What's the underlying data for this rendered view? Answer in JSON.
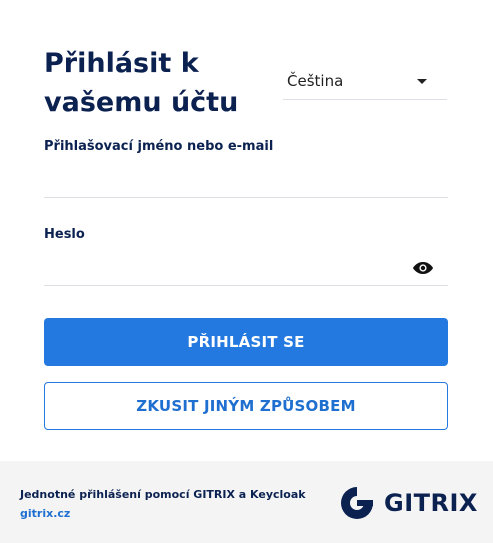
{
  "login": {
    "title": "Přihlásit k vašemu účtu",
    "language": {
      "selected": "Čeština",
      "caret_icon": "chevron-down-icon"
    },
    "username": {
      "label": "Přihlašovací jméno nebo e-mail",
      "value": "",
      "placeholder": ""
    },
    "password": {
      "label": "Heslo",
      "value": "",
      "placeholder": "",
      "toggle_icon": "eye-icon"
    },
    "submit_label": "PŘIHLÁSIT SE",
    "alt_label": "ZKUSIT JINÝM ZPŮSOBEM"
  },
  "footer": {
    "text": "Jednotné přihlášení pomocí GITRIX a Keycloak",
    "link": "gitrix.cz",
    "brand": "GITRIX"
  },
  "colors": {
    "primary": "#2479e0",
    "navy": "#0b2150",
    "footer_bg": "#f4f4f5"
  }
}
